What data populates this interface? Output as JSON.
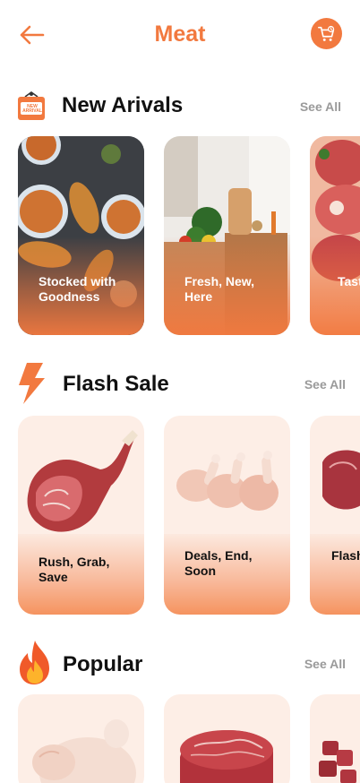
{
  "header": {
    "title": "Meat",
    "back_icon": "arrow-left-icon",
    "cart_icon": "cart-icon"
  },
  "sections": {
    "new_arrivals": {
      "title": "New Arivals",
      "see_all": "See All",
      "badge_text": "NEW ARRIVAL",
      "items": [
        {
          "label": "Stocked with Goodness"
        },
        {
          "label": "Fresh, New, Here"
        },
        {
          "label": "Taste Fresh"
        }
      ]
    },
    "flash_sale": {
      "title": "Flash Sale",
      "see_all": "See All",
      "items": [
        {
          "label": "Rush, Grab, Save"
        },
        {
          "label": "Deals, End, Soon"
        },
        {
          "label": "Flash Dash"
        }
      ]
    },
    "popular": {
      "title": "Popular",
      "see_all": "See All"
    }
  },
  "colors": {
    "accent": "#F2793F",
    "card_bg": "#FDEEE6",
    "muted": "#9A9A9A"
  }
}
